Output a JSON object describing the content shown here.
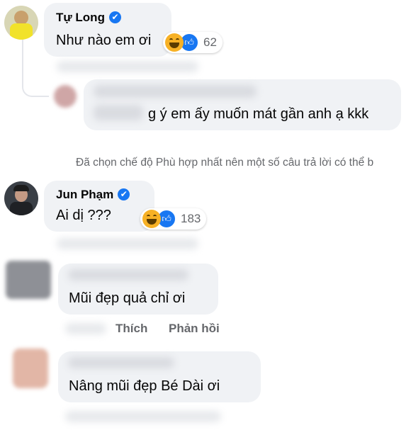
{
  "comments": [
    {
      "author": "Tự Long",
      "text": "Như nào em ơi",
      "reaction_count": "62"
    },
    {
      "text": "g ý em ấy muốn mát gần anh ạ kkk"
    },
    {
      "author": "Jun Phạm",
      "text": "Ai dị ???",
      "reaction_count": "183"
    },
    {
      "text": "Mũi đẹp quả chỉ ơi",
      "actions": [
        "Thích",
        "Phản hồi"
      ]
    },
    {
      "text": "Nâng mũi đẹp Bé Dài ơi"
    }
  ],
  "notice": "Đã chọn chế độ Phù hợp nhất nên một số câu trả lời có thể b",
  "colors": {
    "bubble": "#f0f2f5",
    "verified": "#1877f2",
    "like": "#1877f2",
    "haha": "#f7b125",
    "meta_text": "#65676b"
  },
  "icons": [
    "verified-badge-icon",
    "haha-reaction-icon",
    "like-reaction-icon"
  ]
}
